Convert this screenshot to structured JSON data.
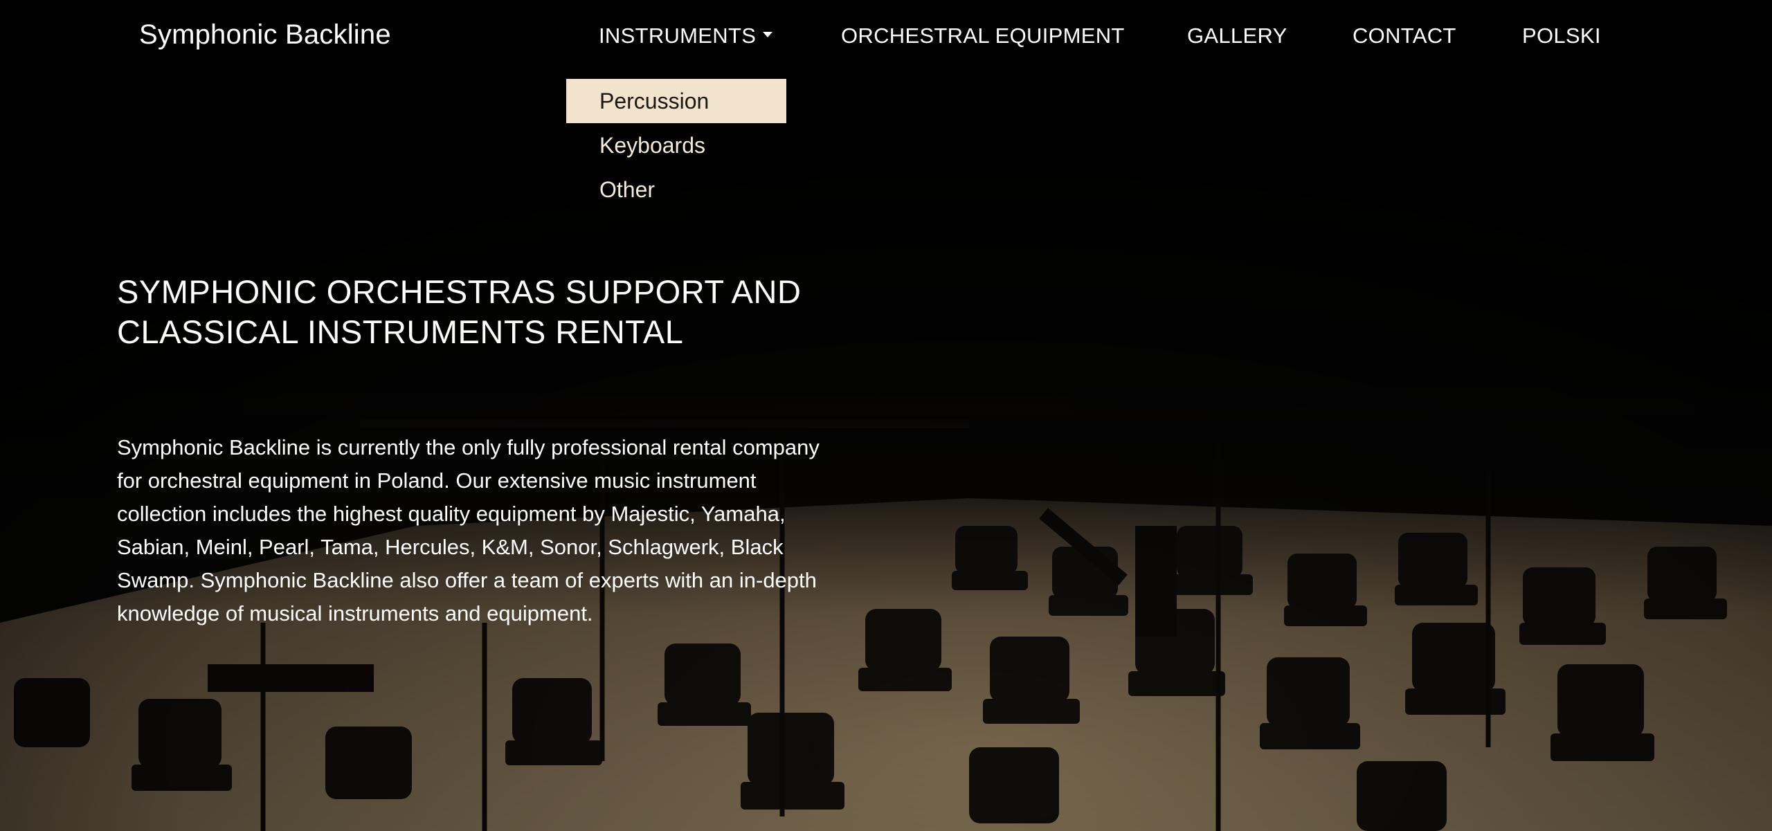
{
  "brand": "Symphonic Backline",
  "nav": {
    "instruments": "INSTRUMENTS",
    "orchestral": "ORCHESTRAL EQUIPMENT",
    "gallery": "GALLERY",
    "contact": "CONTACT",
    "language": "POLSKI"
  },
  "dropdown": {
    "items": [
      "Percussion",
      "Keyboards",
      "Other"
    ],
    "highlighted": "Percussion"
  },
  "hero": {
    "title_line1": "SYMPHONIC ORCHESTRAS SUPPORT AND",
    "title_line2": "CLASSICAL INSTRUMENTS RENTAL",
    "paragraph": "Symphonic Backline is currently the only fully professional rental company for orchestral equipment in Poland. Our extensive music instrument collection includes the highest quality equipment by Majestic, Yamaha, Sabian, Meinl, Pearl, Tama, Hercules, K&M, Sonor, Schlagwerk, Black Swamp. Symphonic Backline also offer a team of experts with an in-depth knowledge of musical instruments and equipment."
  },
  "colors": {
    "background": "#070605",
    "stage_floor": "#a8926f",
    "dropdown_highlight": "#f1e3cc",
    "text": "#ffffff"
  },
  "icons": {
    "dropdown_caret": "caret-down-icon"
  }
}
